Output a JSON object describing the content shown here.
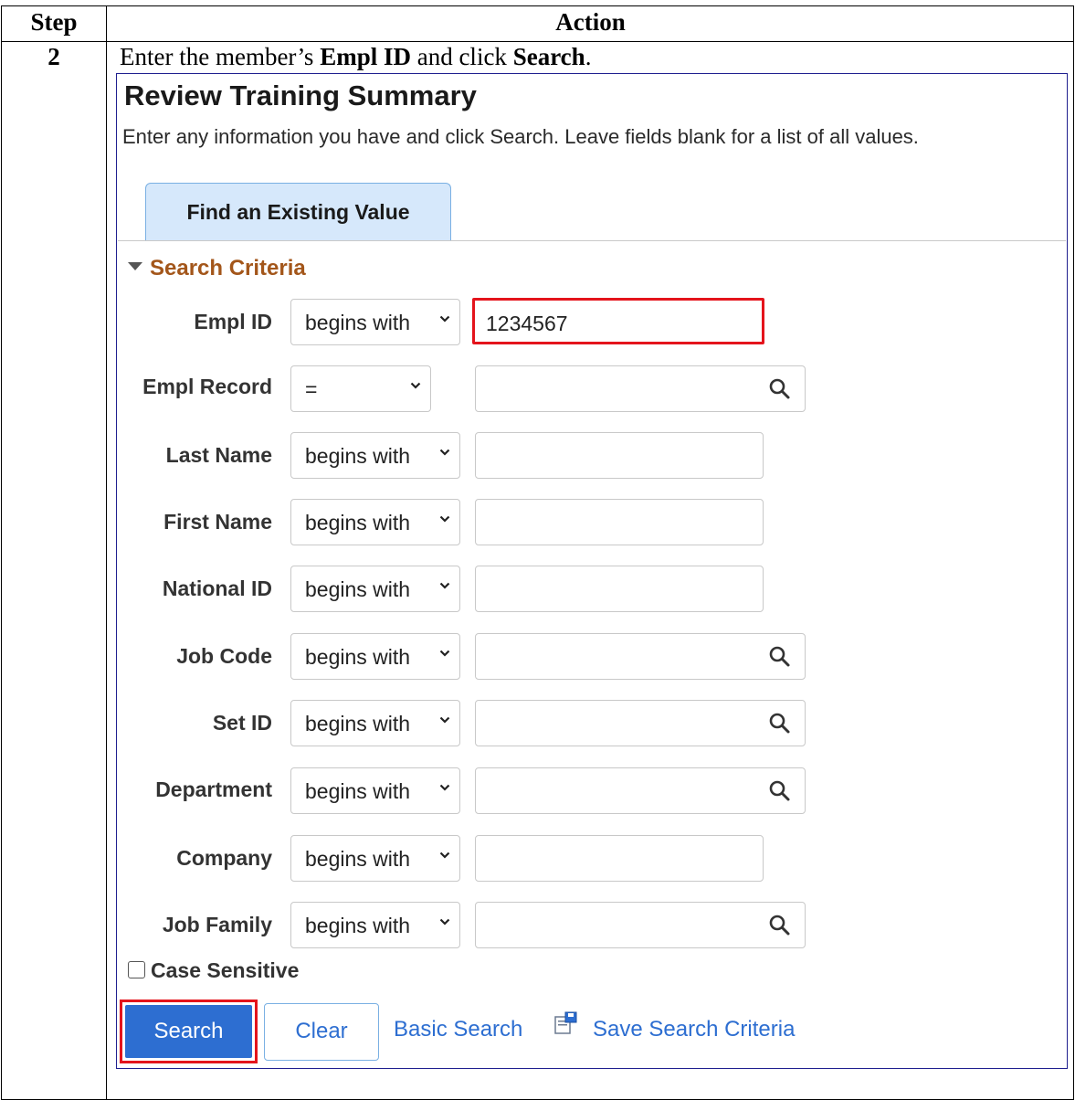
{
  "table": {
    "header_step": "Step",
    "header_action": "Action",
    "step_number": "2",
    "instruction_pre": "Enter the member’s ",
    "instruction_b1": "Empl ID",
    "instruction_mid": " and click ",
    "instruction_b2": "Search",
    "instruction_post": "."
  },
  "page": {
    "title": "Review Training Summary",
    "description": "Enter any information you have and click Search. Leave fields blank for a list of all values.",
    "tab_label": "Find an Existing Value",
    "section_title": "Search Criteria"
  },
  "fields": [
    {
      "label": "Empl ID",
      "operator": "begins with",
      "value": "1234567",
      "lookup": false,
      "highlighted": true
    },
    {
      "label": "Empl Record",
      "operator": "=",
      "value": "",
      "lookup": true
    },
    {
      "label": "Last Name",
      "operator": "begins with",
      "value": "",
      "lookup": false
    },
    {
      "label": "First Name",
      "operator": "begins with",
      "value": "",
      "lookup": false
    },
    {
      "label": "National ID",
      "operator": "begins with",
      "value": "",
      "lookup": false
    },
    {
      "label": "Job Code",
      "operator": "begins with",
      "value": "",
      "lookup": true
    },
    {
      "label": "Set ID",
      "operator": "begins with",
      "value": "",
      "lookup": true
    },
    {
      "label": "Department",
      "operator": "begins with",
      "value": "",
      "lookup": true
    },
    {
      "label": "Company",
      "operator": "begins with",
      "value": "",
      "lookup": false
    },
    {
      "label": "Job Family",
      "operator": "begins with",
      "value": "",
      "lookup": true
    }
  ],
  "case_sensitive": {
    "label": "Case Sensitive",
    "checked": false
  },
  "buttons": {
    "search": "Search",
    "clear": "Clear",
    "basic_search": "Basic Search",
    "save_search": "Save Search Criteria"
  },
  "colors": {
    "highlight": "#e4141c",
    "primary_button": "#2d6ed1",
    "section_title": "#a3561a",
    "tab_fill": "#d6e8fb"
  }
}
